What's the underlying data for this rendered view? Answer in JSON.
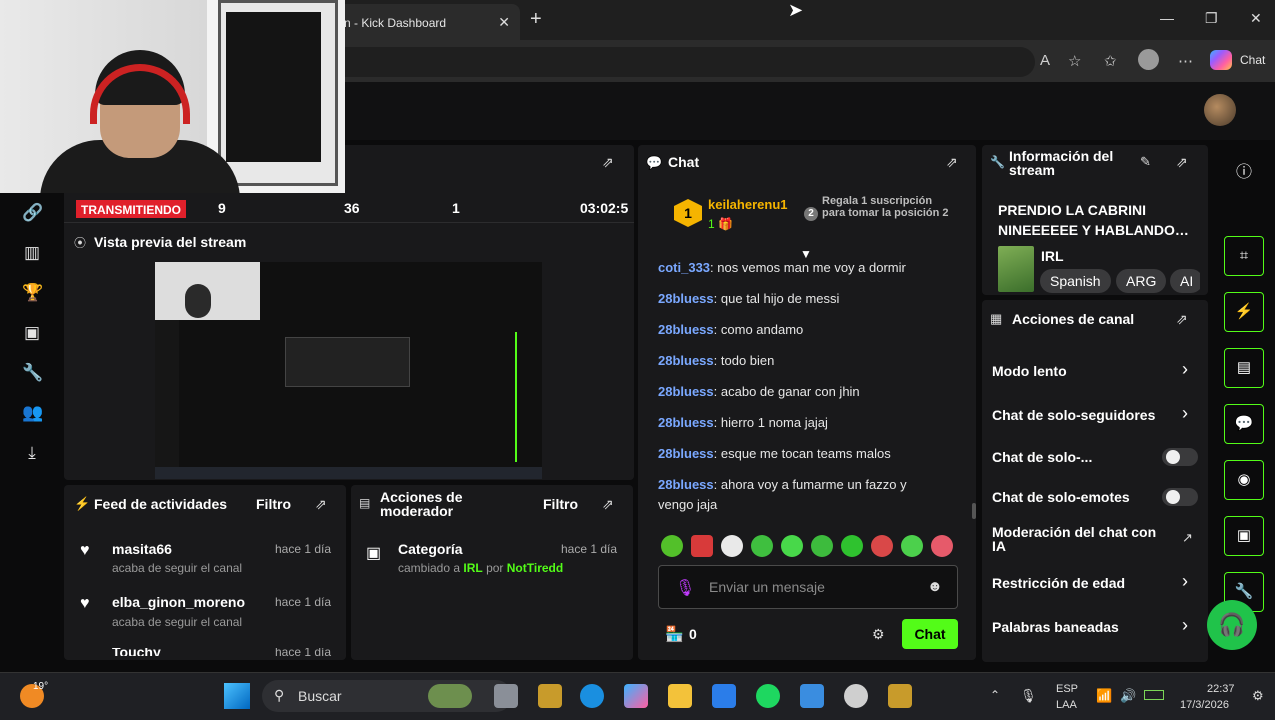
{
  "browser": {
    "tab_title": "n - Kick Dashboard",
    "tab_close": "✕",
    "new_tab": "+",
    "copilot_label": "Chat"
  },
  "stats": {
    "live_label": "TRANSMITIENDO",
    "viewers": "9",
    "followers": "36",
    "subs": "1",
    "duration": "03:02:5"
  },
  "preview": {
    "title": "Vista previa del stream"
  },
  "activity": {
    "title": "Feed de actividades",
    "filter": "Filtro",
    "items": [
      {
        "user": "masita66",
        "time": "hace 1 día",
        "desc": "acaba de seguir el canal"
      },
      {
        "user": "elba_ginon_moreno",
        "time": "hace 1 día",
        "desc": "acaba de seguir el canal"
      },
      {
        "user": "Touchy",
        "time": "hace 1 día",
        "desc": ""
      }
    ]
  },
  "mod_actions": {
    "title_line1": "Acciones de",
    "title_line2": "moderador",
    "filter": "Filtro",
    "item": {
      "title": "Categoría",
      "time": "hace 1 día",
      "prefix": "cambiado a",
      "category": "IRL",
      "by": "por",
      "moderator": "NotTiredd"
    }
  },
  "chat": {
    "title": "Chat",
    "top_gifter": {
      "rank": "1",
      "user": "keilaherenu1",
      "count": "1"
    },
    "gift_promo_rank": "2",
    "gift_promo": "Regala 1 suscripción para tomar la posición 2",
    "messages": [
      {
        "user": "coti_333",
        "text": "nos vemos man me voy a dormir"
      },
      {
        "user": "28bluess",
        "text": "que tal hijo de messi"
      },
      {
        "user": "28bluess",
        "text": "como andamo"
      },
      {
        "user": "28bluess",
        "text": "todo bien"
      },
      {
        "user": "28bluess",
        "text": "acabo de ganar con jhin"
      },
      {
        "user": "28bluess",
        "text": "hierro 1 noma jajaj"
      },
      {
        "user": "28bluess",
        "text": "esque me tocan teams malos"
      },
      {
        "user": "28bluess",
        "text": "ahora voy a fumarme un fazzo y vengo jaja"
      }
    ],
    "input_placeholder": "Enviar un mensaje",
    "points": "0",
    "send_label": "Chat"
  },
  "stream_info": {
    "title_line1": "Información del",
    "title_line2": "stream",
    "stream_title": "PRENDIO LA CABRINI NINEEEEEE Y HABLANDO…",
    "category": "IRL",
    "tags": [
      "Spanish",
      "ARG",
      "AI"
    ]
  },
  "channel_actions": {
    "title": "Acciones de canal",
    "items": [
      {
        "label": "Modo lento",
        "control": "chevron"
      },
      {
        "label": "Chat de solo-seguidores",
        "control": "chevron"
      },
      {
        "label": "Chat de solo-...",
        "control": "toggle"
      },
      {
        "label": "Chat de solo-emotes",
        "control": "toggle"
      },
      {
        "label": "Moderación del chat con IA",
        "control": "external"
      },
      {
        "label": "Restricción de edad",
        "control": "chevron"
      },
      {
        "label": "Palabras baneadas",
        "control": "chevron"
      }
    ]
  },
  "taskbar": {
    "weather": "19°",
    "search": "Buscar",
    "lang_line1": "ESP",
    "lang_line2": "LAA",
    "time": "22:37",
    "date": "17/3/2026"
  },
  "colors": {
    "kick_green": "#53fc18",
    "live_red": "#e0202b",
    "username_blue": "#7aa8ff"
  }
}
